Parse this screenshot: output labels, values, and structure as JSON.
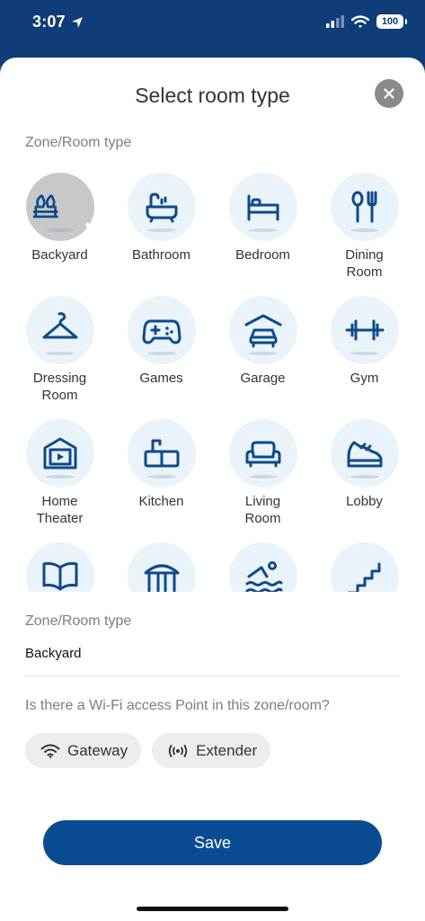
{
  "status_bar": {
    "time": "3:07",
    "battery": "100"
  },
  "sheet": {
    "title": "Select room type",
    "grid_label": "Zone/Room type",
    "rooms": [
      {
        "label": "Backyard",
        "icon": "backyard-icon",
        "selected": true
      },
      {
        "label": "Bathroom",
        "icon": "bathtub-icon"
      },
      {
        "label": "Bedroom",
        "icon": "bed-icon"
      },
      {
        "label": "Dining\nRoom",
        "icon": "fork-spoon-icon"
      },
      {
        "label": "Dressing\nRoom",
        "icon": "hanger-icon"
      },
      {
        "label": "Games",
        "icon": "gamepad-icon"
      },
      {
        "label": "Garage",
        "icon": "garage-icon"
      },
      {
        "label": "Gym",
        "icon": "dumbbell-icon"
      },
      {
        "label": "Home\nTheater",
        "icon": "home-theater-icon"
      },
      {
        "label": "Kitchen",
        "icon": "kitchen-icon"
      },
      {
        "label": "Living\nRoom",
        "icon": "sofa-icon"
      },
      {
        "label": "Lobby",
        "icon": "shoe-icon"
      },
      {
        "label": "",
        "icon": "book-icon"
      },
      {
        "label": "",
        "icon": "gazebo-icon"
      },
      {
        "label": "",
        "icon": "swimmer-icon"
      },
      {
        "label": "",
        "icon": "stairs-icon"
      }
    ],
    "field_label": "Zone/Room type",
    "field_value": "Backyard",
    "question": "Is there a Wi-Fi access Point in this zone/room?",
    "chips": [
      {
        "label": "Gateway",
        "icon": "wifi-icon"
      },
      {
        "label": "Extender",
        "icon": "extender-icon"
      }
    ],
    "save_label": "Save"
  },
  "colors": {
    "header_bg": "#0e3d78",
    "primary": "#0a4c94",
    "icon_blue": "#0d4a8c",
    "tile_bg": "#eaf3fa"
  }
}
